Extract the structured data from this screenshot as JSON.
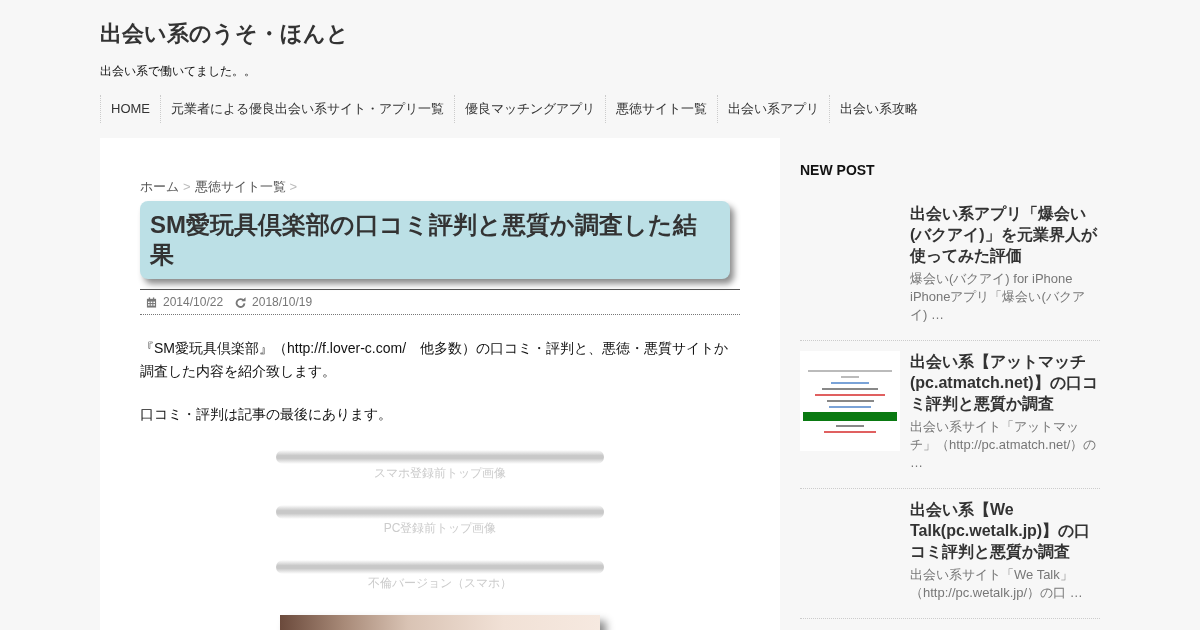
{
  "site": {
    "title": "出会い系のうそ・ほんと",
    "tagline": "出会い系で働いてました。。"
  },
  "nav": [
    "HOME",
    "元業者による優良出会い系サイト・アプリ一覧",
    "優良マッチングアプリ",
    "悪徳サイト一覧",
    "出会い系アプリ",
    "出会い系攻略"
  ],
  "breadcrumb": {
    "items": [
      "ホーム",
      "悪徳サイト一覧"
    ],
    "separator": ">"
  },
  "article": {
    "title": "SM愛玩具倶楽部の口コミ評判と悪質か調査した結果",
    "published": "2014/10/22",
    "updated": "2018/10/19",
    "paragraphs": [
      "『SM愛玩具倶楽部』（http://f.lover-c.com/　他多数）の口コミ・評判と、悪徳・悪質サイトか調査した内容を紹介致します。",
      "口コミ・評判は記事の最後にあります。"
    ],
    "figures": [
      {
        "kind": "placeholder",
        "caption": "スマホ登録前トップ画像"
      },
      {
        "kind": "placeholder",
        "caption": "PC登録前トップ画像"
      },
      {
        "kind": "placeholder",
        "caption": "不倫バージョン（スマホ）"
      },
      {
        "kind": "photo"
      }
    ]
  },
  "sidebar": {
    "heading": "NEW POST",
    "posts": [
      {
        "title": "出会い系アプリ「爆会い(バクアイ)」を元業界人が使ってみた評価",
        "excerpt": "爆会い(バクアイ) for iPhone iPhoneアプリ「爆会い(バクアイ) …",
        "thumbnail": false
      },
      {
        "title": "出会い系【アットマッチ(pc.atmatch.net)】の口コミ評判と悪質か調査",
        "excerpt": "出会い系サイト「アットマッチ」（http://pc.atmatch.net/）の …",
        "thumbnail": true
      },
      {
        "title": "出会い系【We Talk(pc.wetalk.jp)】の口コミ評判と悪質か調査",
        "excerpt": "出会い系サイト「We Talk」（http://pc.wetalk.jp/）の口 …",
        "thumbnail": false
      }
    ]
  }
}
